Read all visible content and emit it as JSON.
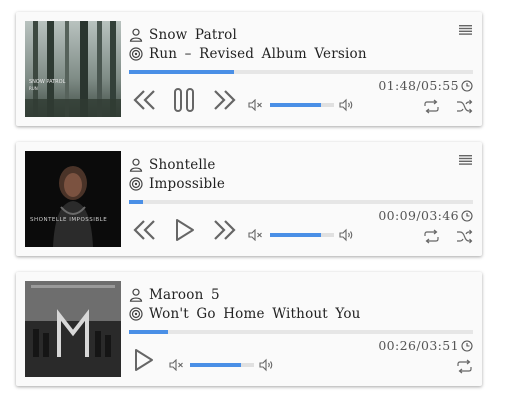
{
  "tracks": [
    {
      "artist": "Snow  Patrol",
      "title": "Run  –  Revised  Album  Version",
      "current_time": "01:48",
      "duration": "05:55",
      "progress": 0.304,
      "volume": 0.79,
      "state": "playing",
      "cover_text": "SNOW PATROL\nRUN"
    },
    {
      "artist": "Shontelle",
      "title": "Impossible",
      "current_time": "00:09",
      "duration": "03:46",
      "progress": 0.04,
      "volume": 0.79,
      "state": "paused",
      "cover_text": "SHONTELLE IMPOSSIBLE"
    },
    {
      "artist": "Maroon  5",
      "title": "Won't  Go  Home  Without  You",
      "current_time": "00:26",
      "duration": "03:51",
      "progress": 0.112,
      "volume": 0.79,
      "state": "paused"
    }
  ],
  "time_separator": "/",
  "icons": {
    "artist": "user-icon",
    "title": "disc-icon",
    "menu": "menu-icon",
    "clock": "clock-icon",
    "prev": "previous-icon",
    "next": "next-icon",
    "play": "play-icon",
    "pause": "pause-icon",
    "mute": "mute-icon",
    "volume": "volume-icon",
    "repeat": "repeat-icon",
    "shuffle": "shuffle-icon"
  },
  "colors": {
    "accent": "#4a8fe6",
    "icon": "#666666",
    "card_bg": "#fafafa"
  }
}
